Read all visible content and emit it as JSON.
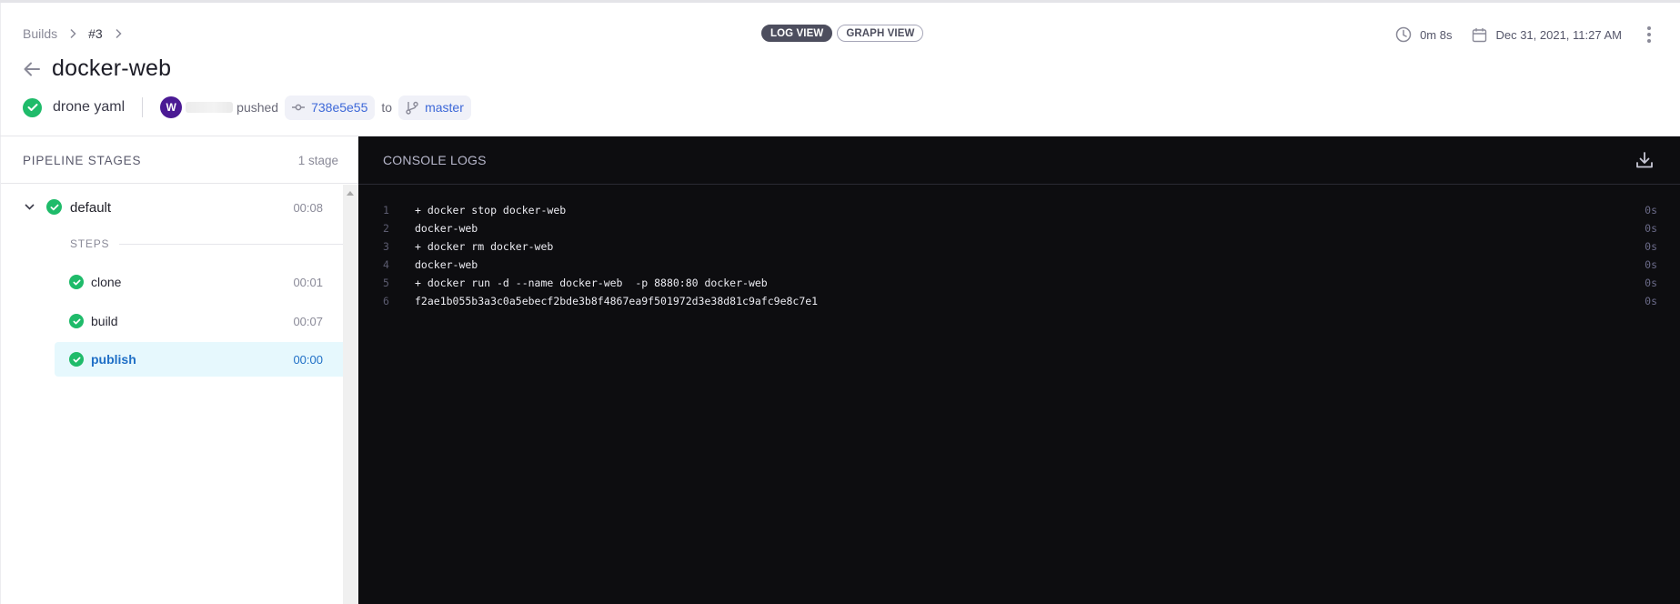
{
  "breadcrumb": {
    "items": [
      "Builds",
      "#3"
    ]
  },
  "header": {
    "title": "docker-web",
    "build_message": "drone yaml",
    "author_initial": "W",
    "action": "pushed",
    "commit": "738e5e55",
    "to_label": "to",
    "branch": "master",
    "view_toggle": {
      "log_view": "LOG VIEW",
      "graph_view": "GRAPH VIEW",
      "active": "log_view"
    },
    "duration": "0m 8s",
    "date": "Dec 31, 2021, 11:27 AM"
  },
  "colors": {
    "success": "#1fbb6a",
    "accent": "#3d68d8",
    "avatar": "#4b1a94",
    "console_bg": "#0d0d10",
    "selected_bg": "#e6f8fd"
  },
  "sidebar": {
    "title": "PIPELINE STAGES",
    "count": "1 stage",
    "stage": {
      "name": "default",
      "duration": "00:08",
      "status": "success",
      "expanded": true
    },
    "steps_label": "STEPS",
    "steps": [
      {
        "name": "clone",
        "duration": "00:01",
        "status": "success",
        "selected": false
      },
      {
        "name": "build",
        "duration": "00:07",
        "status": "success",
        "selected": false
      },
      {
        "name": "publish",
        "duration": "00:00",
        "status": "success",
        "selected": true
      }
    ]
  },
  "console": {
    "title": "CONSOLE LOGS",
    "download_icon": "download-icon",
    "lines": [
      {
        "num": "1",
        "text": "+ docker stop docker-web",
        "time": "0s"
      },
      {
        "num": "2",
        "text": "docker-web",
        "time": "0s"
      },
      {
        "num": "3",
        "text": "+ docker rm docker-web",
        "time": "0s"
      },
      {
        "num": "4",
        "text": "docker-web",
        "time": "0s"
      },
      {
        "num": "5",
        "text": "+ docker run -d --name docker-web  -p 8880:80 docker-web",
        "time": "0s"
      },
      {
        "num": "6",
        "text": "f2ae1b055b3a3c0a5ebecf2bde3b8f4867ea9f501972d3e38d81c9afc9e8c7e1",
        "time": "0s"
      }
    ]
  }
}
